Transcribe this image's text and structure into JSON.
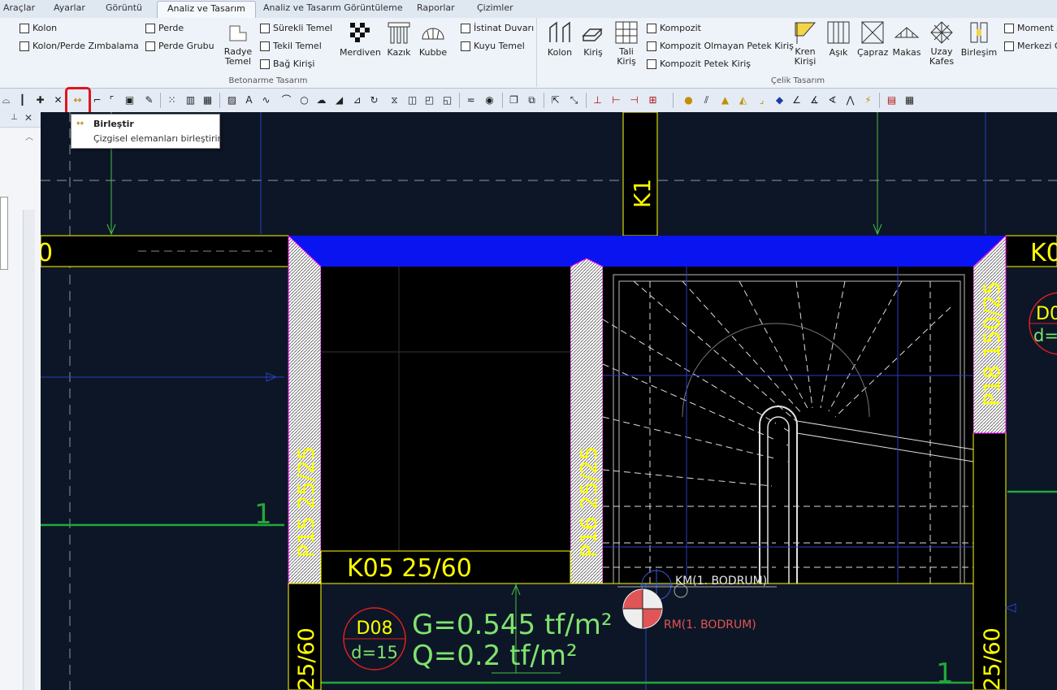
{
  "menu": {
    "tabs": [
      "Araçlar",
      "Ayarlar",
      "Görüntü",
      "Analiz ve Tasarım",
      "Analiz ve Tasarım Görüntüleme",
      "Raporlar",
      "Çizimler"
    ],
    "active": "Analiz ve Tasarım"
  },
  "ribbon": {
    "betonarme": {
      "label": "Betonarme Tasarım",
      "kolon": "Kolon",
      "kolon_perde": "Kolon/Perde Zımbalama",
      "perde": "Perde",
      "perde_grubu": "Perde Grubu",
      "radye": "Radye\nTemel",
      "surekli": "Sürekli Temel",
      "tekil": "Tekil Temel",
      "bag": "Bağ Kirişi",
      "merdiven": "Merdiven",
      "kazik": "Kazık",
      "kubbe": "Kubbe",
      "istinat": "İstinat Duvarı",
      "kuyu": "Kuyu Temel"
    },
    "celik": {
      "label": "Çelik Tasarım",
      "kolon": "Kolon",
      "kiris": "Kiriş",
      "tali": "Tali\nKiriş",
      "kompozit": "Kompozit",
      "kompozit_olmayan": "Kompozit Olmayan Petek Kiriş",
      "kompozit_petek": "Kompozit Petek Kiriş",
      "kren": "Kren\nKirişi",
      "asik": "Aşık",
      "capraz": "Çapraz",
      "makas": "Makas",
      "uzay": "Uzay\nKafes",
      "birlesim": "Birleşim",
      "moment": "Moment A",
      "merkezi": "Merkezi G"
    }
  },
  "tooltip": {
    "title": "Birleştir",
    "desc": "Çizgisel elemanları birleştirir."
  },
  "drawing": {
    "beam_top_left": "0",
    "beam_top_right": "K0",
    "column_top": "K1",
    "wall_left": "P15 25/25",
    "wall_mid": "P16 25/25",
    "wall_right": "P18 150/25",
    "beam_k05": "K05 25/60",
    "slab_id": "D08",
    "slab_d": "d=15",
    "load_g": "G=0.545 tf/m²",
    "load_q": "Q=0.2 tf/m²",
    "km_label": "KM(1. BODRUM)",
    "rm_label": "RM(1. BODRUM)",
    "axis_left": "1",
    "axis_bottom": "1",
    "bottom_left_dim": "25/60",
    "bottom_right_dim": "25/60",
    "right_slab_id": "D0",
    "right_slab_d": "d="
  },
  "colors": {
    "canvas_bg": "#0d1626",
    "beam_blue": "#0a14f0",
    "label_yellow": "#ffff00",
    "load_green": "#7fe36f",
    "rm_red": "#e05555",
    "highlight_red": "#e0141e"
  }
}
